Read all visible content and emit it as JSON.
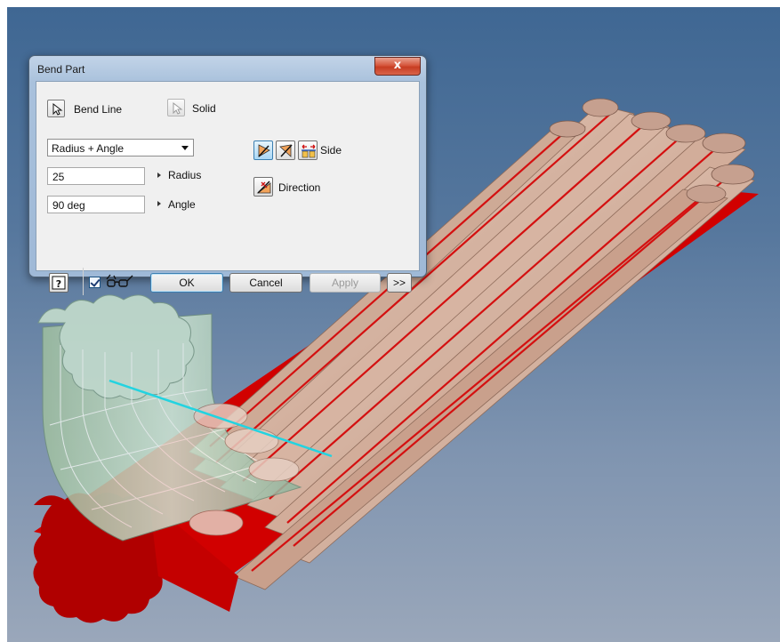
{
  "dialog": {
    "title": "Bend Part",
    "close_label": "x",
    "bend_line_label": "Bend Line",
    "solid_label": "Solid",
    "mode": {
      "selected": "Radius + Angle"
    },
    "radius": {
      "value": "25",
      "label": "Radius"
    },
    "angle": {
      "value": "90 deg",
      "label": "Angle"
    },
    "side_label": "Side",
    "direction_label": "Direction",
    "preview_checked": true,
    "buttons": {
      "ok": "OK",
      "cancel": "Cancel",
      "apply": "Apply",
      "more": ">>"
    }
  },
  "icons": [
    "pointer-icon",
    "pointer-icon-disabled",
    "side-flip-icon",
    "side-symmetric-icon",
    "side-both-icon",
    "direction-icon",
    "help-icon",
    "glasses-icon"
  ],
  "colors": {
    "viewport_top": "#3f6793",
    "viewport_bottom": "#9aa7ba",
    "bent_part": "#a8c7b0",
    "straight_rods": "#d8b39f",
    "cut_end": "#cc0000",
    "bend_line": "#23d3e0",
    "dialog_frame": "#a9c1dc"
  }
}
